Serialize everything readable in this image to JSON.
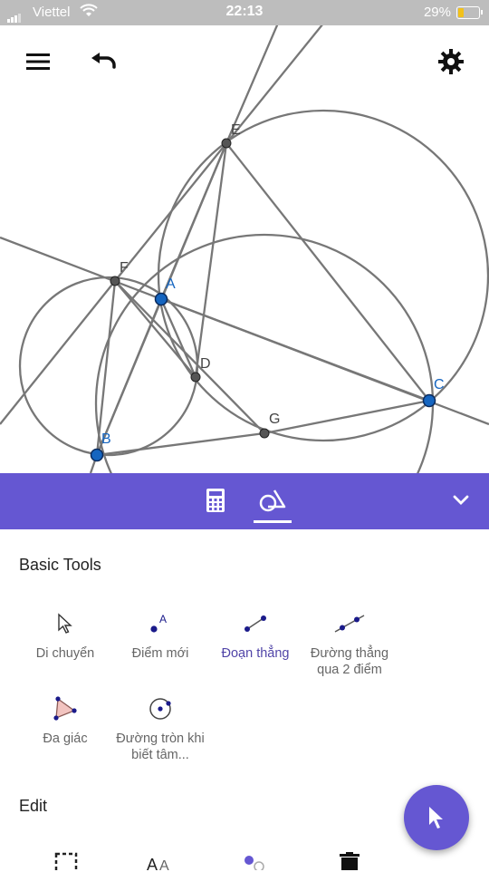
{
  "status": {
    "carrier": "Viettel",
    "time": "22:13",
    "battery": "29%"
  },
  "geometry": {
    "points": [
      {
        "label": "E"
      },
      {
        "label": "F"
      },
      {
        "label": "A"
      },
      {
        "label": "D"
      },
      {
        "label": "C"
      },
      {
        "label": "G"
      },
      {
        "label": "B"
      }
    ]
  },
  "toolbar": {
    "menu_icon": "menu-icon",
    "undo_icon": "undo-icon",
    "settings_icon": "gear-icon"
  },
  "tabs": [
    {
      "name": "calculator-icon"
    },
    {
      "name": "tools-icon",
      "active": true
    }
  ],
  "sections": {
    "basic": "Basic Tools",
    "edit": "Edit"
  },
  "tools": [
    {
      "label": "Di chuyển"
    },
    {
      "label": "Điểm mới"
    },
    {
      "label": "Đoạn thẳng",
      "active": true
    },
    {
      "label": "Đường thẳng qua 2 điểm"
    },
    {
      "label": "Đa giác"
    },
    {
      "label": "Đường tròn khi biết tâm..."
    }
  ],
  "colors": {
    "accent": "#6557d2",
    "point_blue": "#1565c0",
    "active_label": "#5145a8"
  }
}
